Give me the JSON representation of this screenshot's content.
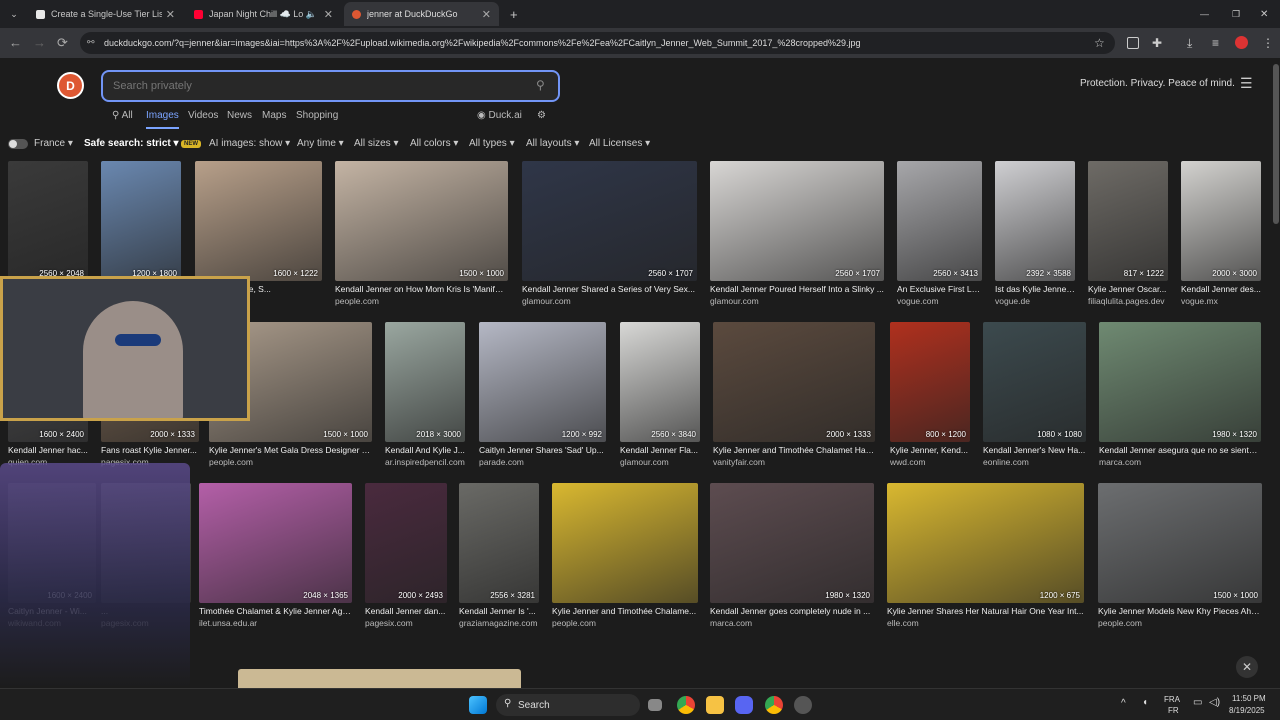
{
  "tabs": [
    {
      "title": "Create a Single-Use Tier List (Pr",
      "color": "#e8e8e8",
      "close": "✕"
    },
    {
      "title": "Japan Night Chill ☁️ Lofi C",
      "color": "#ff0033",
      "close": "✕"
    },
    {
      "title": "jenner at DuckDuckGo",
      "color": "#de5833",
      "close": "✕"
    }
  ],
  "new_tab": "+",
  "window": {
    "min": "—",
    "restore": "❐",
    "close": "✕"
  },
  "url": "duckduckgo.com/?q=jenner&iar=images&iai=https%3A%2F%2Fupload.wikimedia.org%2Fwikipedia%2Fcommons%2Fe%2Fea%2FCaitlyn_Jenner_Web_Summit_2017_%28cropped%29.jpg",
  "search": {
    "placeholder": "Search privately"
  },
  "tagline": "Protection. Privacy. Peace of mind.",
  "nav_tabs": [
    "All",
    "Images",
    "Videos",
    "News",
    "Maps",
    "Shopping"
  ],
  "duck_ai": "Duck.ai",
  "filters": {
    "region": "France ▾",
    "safe": "Safe search: strict ▾",
    "new_badge": "NEW",
    "ai_images": "AI images: show ▾",
    "time": "Any time ▾",
    "sizes": "All sizes ▾",
    "colors": "All colors ▾",
    "types": "All types ▾",
    "layouts": "All layouts ▾",
    "licenses": "All Licenses ▾"
  },
  "results": [
    {
      "title": "",
      "source": "",
      "dims": "2560 × 2048",
      "color": "#3a3a3a"
    },
    {
      "title": "",
      "source": "",
      "dims": "1200 × 1800",
      "color": "#6a88b0"
    },
    {
      "title": "...iography, Age, S...",
      "source": "",
      "dims": "1600 × 1222",
      "color": "#b8a08a"
    },
    {
      "title": "Kendall Jenner on How Mom Kris Is 'Manifes...",
      "source": "people.com",
      "dims": "1500 × 1000",
      "color": "#c4b4a4"
    },
    {
      "title": "Kendall Jenner Shared a Series of Very Sex...",
      "source": "glamour.com",
      "dims": "2560 × 1707",
      "color": "#2f3648"
    },
    {
      "title": "Kendall Jenner Poured Herself Into a Slinky ...",
      "source": "glamour.com",
      "dims": "2560 × 1707",
      "color": "#d8d6d4"
    },
    {
      "title": "An Exclusive First Lo...",
      "source": "vogue.com",
      "dims": "2560 × 3413",
      "color": "#a7a7aa"
    },
    {
      "title": "Ist das Kylie Jenner...",
      "source": "vogue.de",
      "dims": "2392 × 3588",
      "color": "#cfcfd2"
    },
    {
      "title": "Kylie Jenner Oscar...",
      "source": "filiaqlulita.pages.dev",
      "dims": "817 × 1222",
      "color": "#6e6b66"
    },
    {
      "title": "Kendall Jenner des...",
      "source": "vogue.mx",
      "dims": "2000 × 3000",
      "color": "#d3d2cf"
    },
    {
      "title": "Kendall Jenner hac...",
      "source": "quien.com",
      "dims": "1600 × 2400",
      "color": "#4d4d4f"
    },
    {
      "title": "Fans roast Kylie Jenner...",
      "source": "pagesix.com",
      "dims": "2000 × 1333",
      "color": "#7c6652"
    },
    {
      "title": "Kylie Jenner's Met Gala Dress Designer T...",
      "source": "people.com",
      "dims": "1500 × 1000",
      "color": "#a99a8a"
    },
    {
      "title": "Kendall And Kylie J...",
      "source": "ar.inspiredpencil.com",
      "dims": "2018 × 3000",
      "color": "#9aa7a0"
    },
    {
      "title": "Caitlyn Jenner Shares 'Sad' Up...",
      "source": "parade.com",
      "dims": "1200 × 992",
      "color": "#b5b8c5"
    },
    {
      "title": "Kendall Jenner Fla...",
      "source": "glamour.com",
      "dims": "2560 × 3840",
      "color": "#d8d8d6"
    },
    {
      "title": "Kylie Jenner and Timothée Chalamet Hav...",
      "source": "vanityfair.com",
      "dims": "2000 × 1333",
      "color": "#5b4a3e"
    },
    {
      "title": "Kylie Jenner, Kend...",
      "source": "wwd.com",
      "dims": "800 × 1200",
      "color": "#b0301e"
    },
    {
      "title": "Kendall Jenner's New Ha...",
      "source": "eonline.com",
      "dims": "1080 × 1080",
      "color": "#3c4a4e"
    },
    {
      "title": "Kendall Jenner asegura que no se siente ...",
      "source": "marca.com",
      "dims": "1980 × 1320",
      "color": "#6f8a72"
    },
    {
      "title": "Caitlyn Jenner - Wi...",
      "source": "wikiwand.com",
      "dims": "1600 × 2400",
      "color": "#444"
    },
    {
      "title": "...",
      "source": "pagesix.com",
      "dims": "",
      "color": "#555"
    },
    {
      "title": "Timothée Chalamet & Kylie Jenner Age ...",
      "source": "ilet.unsa.edu.ar",
      "dims": "2048 × 1365",
      "color": "#b45fa8"
    },
    {
      "title": "Kendall Jenner dan...",
      "source": "pagesix.com",
      "dims": "2000 × 2493",
      "color": "#4a2a3e"
    },
    {
      "title": "Kendall Jenner Is '...",
      "source": "graziamagazine.com",
      "dims": "2556 × 3281",
      "color": "#6a6a66"
    },
    {
      "title": "Kylie Jenner and Timothée Chalame...",
      "source": "people.com",
      "dims": "",
      "color": "#d9b830"
    },
    {
      "title": "Kendall Jenner goes completely nude in ...",
      "source": "marca.com",
      "dims": "1980 × 1320",
      "color": "#5d4c50"
    },
    {
      "title": "Kylie Jenner Shares Her Natural Hair One Year Int...",
      "source": "elle.com",
      "dims": "1200 × 675",
      "color": "#d9b830"
    },
    {
      "title": "Kylie Jenner Models New Khy Pieces Ahe...",
      "source": "people.com",
      "dims": "1500 × 1000",
      "color": "#6c6e70"
    }
  ],
  "taskbar": {
    "search": "Search",
    "lang_top": "FRA",
    "lang_bottom": "FR",
    "time": "11:50 PM",
    "date": "8/19/2025"
  },
  "icons": {
    "back": "←",
    "forward": "→",
    "reload": "⟳",
    "search": "⚲",
    "menu": "☰",
    "close": "✕",
    "star": "☆",
    "settings": "⚙",
    "up": "^",
    "mic": "🎤"
  }
}
